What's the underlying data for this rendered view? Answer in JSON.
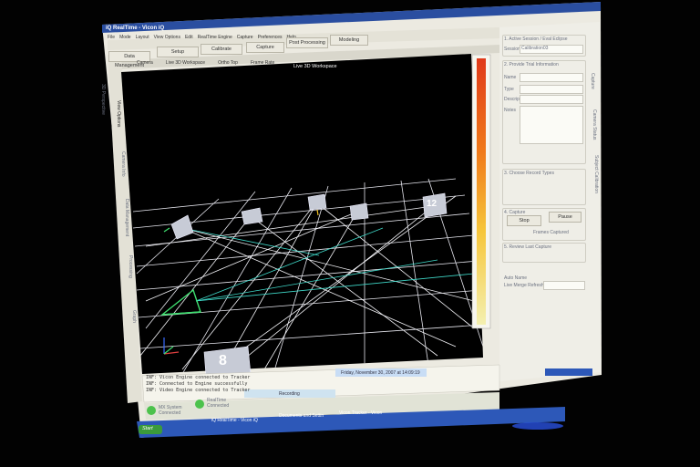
{
  "window": {
    "title": "iQ RealTime - Vicon iQ"
  },
  "menubar": {
    "items": [
      "File",
      "Mode",
      "Layout",
      "View Options",
      "Edit",
      "RealTime Engine",
      "Capture",
      "Preferences",
      "Help"
    ]
  },
  "toolbar": {
    "buttons": [
      "Data Management",
      "Setup",
      "Calibrate",
      "Capture",
      "Post Processing",
      "Modeling"
    ]
  },
  "viewport_bar": {
    "items": [
      "Camera",
      "Live 3D Workspace",
      "Ortho Top",
      "Frame Rate"
    ]
  },
  "viewport": {
    "title": "Live 3D Workspace",
    "camera_labels": [
      "8",
      "12"
    ]
  },
  "left_tabs": [
    "3D Perspective",
    "View Options",
    "Camera Info",
    "Data Management",
    "Processing",
    "Graph"
  ],
  "right_panel": {
    "session_section": {
      "title": "1. Active Session / Eval Eclipse",
      "session_label": "Session",
      "session_value": "Calibration03"
    },
    "trial_section": {
      "title": "2. Provide Trial Information",
      "fields": [
        "Name",
        "Type",
        "Description",
        "Notes"
      ]
    },
    "record_section": {
      "title": "3. Choose Record Types"
    },
    "capture_section": {
      "title": "4. Capture",
      "stop_label": "Stop",
      "pause_label": "Pause",
      "frames_label": "Frames Captured"
    },
    "review_section": {
      "title": "5. Review Last Capture"
    },
    "auto_section": {
      "label_a": "Auto Name",
      "label_b": "Live Merge Refresh"
    },
    "side_tabs": [
      "Capture",
      "Camera Status",
      "Subject Calibration"
    ]
  },
  "log": {
    "lines": [
      "INF:  Vicon Engine connected to Tracker",
      "INF:  Connected to Engine successfully",
      "INF:  Video Engine connected to Tracker"
    ]
  },
  "status": {
    "date": "Friday, November 30, 2007 at 14:09:19",
    "recording": "Recording",
    "mx_system": "MX System Connected",
    "realtime_engine": "RealTime Connected"
  },
  "taskbar": {
    "start_label": "Start",
    "tasks": [
      "iQ RealTime - Vicon iQ",
      "Documents and Settin",
      "Vicon Tracker - Vicon"
    ]
  },
  "colors": {
    "viewport_bg": "#000000",
    "grid": "#e6e6ee",
    "camera_ray": "#3fd9c9",
    "camera_green": "#3fe070",
    "panel_bg": "#ecebe2",
    "title_bar": "#2a4ea0",
    "scale_top": "#e03a1a",
    "scale_bottom": "#f4f0b0"
  }
}
